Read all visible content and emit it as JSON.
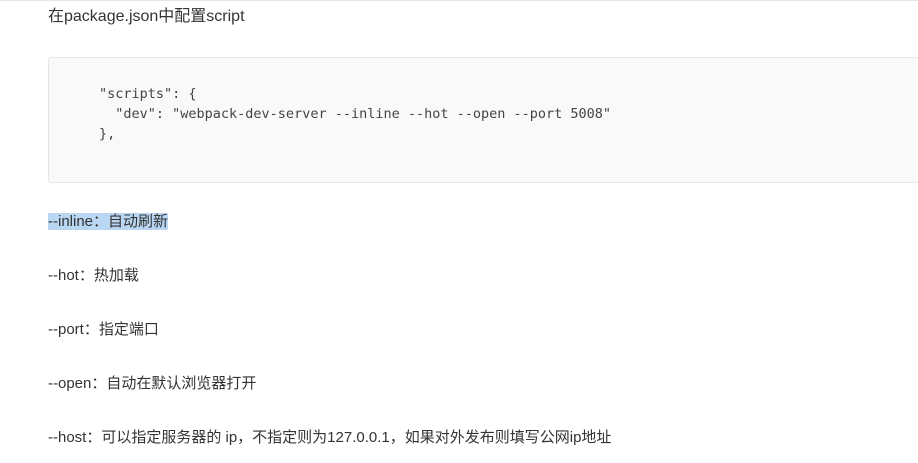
{
  "heading": "在package.json中配置script",
  "code": {
    "lines": [
      "\"scripts\": {",
      "  \"dev\": \"webpack-dev-server --inline --hot --open --port 5008\"",
      "},"
    ]
  },
  "options": [
    {
      "text": "--inline：自动刷新",
      "selected": true
    },
    {
      "text": "--hot：热加载",
      "selected": false
    },
    {
      "text": "--port：指定端口",
      "selected": false
    },
    {
      "text": "--open：自动在默认浏览器打开",
      "selected": false
    },
    {
      "text": "--host：可以指定服务器的 ip，不指定则为127.0.0.1，如果对外发布则填写公网ip地址",
      "selected": false
    }
  ],
  "colors": {
    "selection_highlight": "#b9d7f3",
    "code_background": "#f9f9f9",
    "text": "#333333"
  }
}
